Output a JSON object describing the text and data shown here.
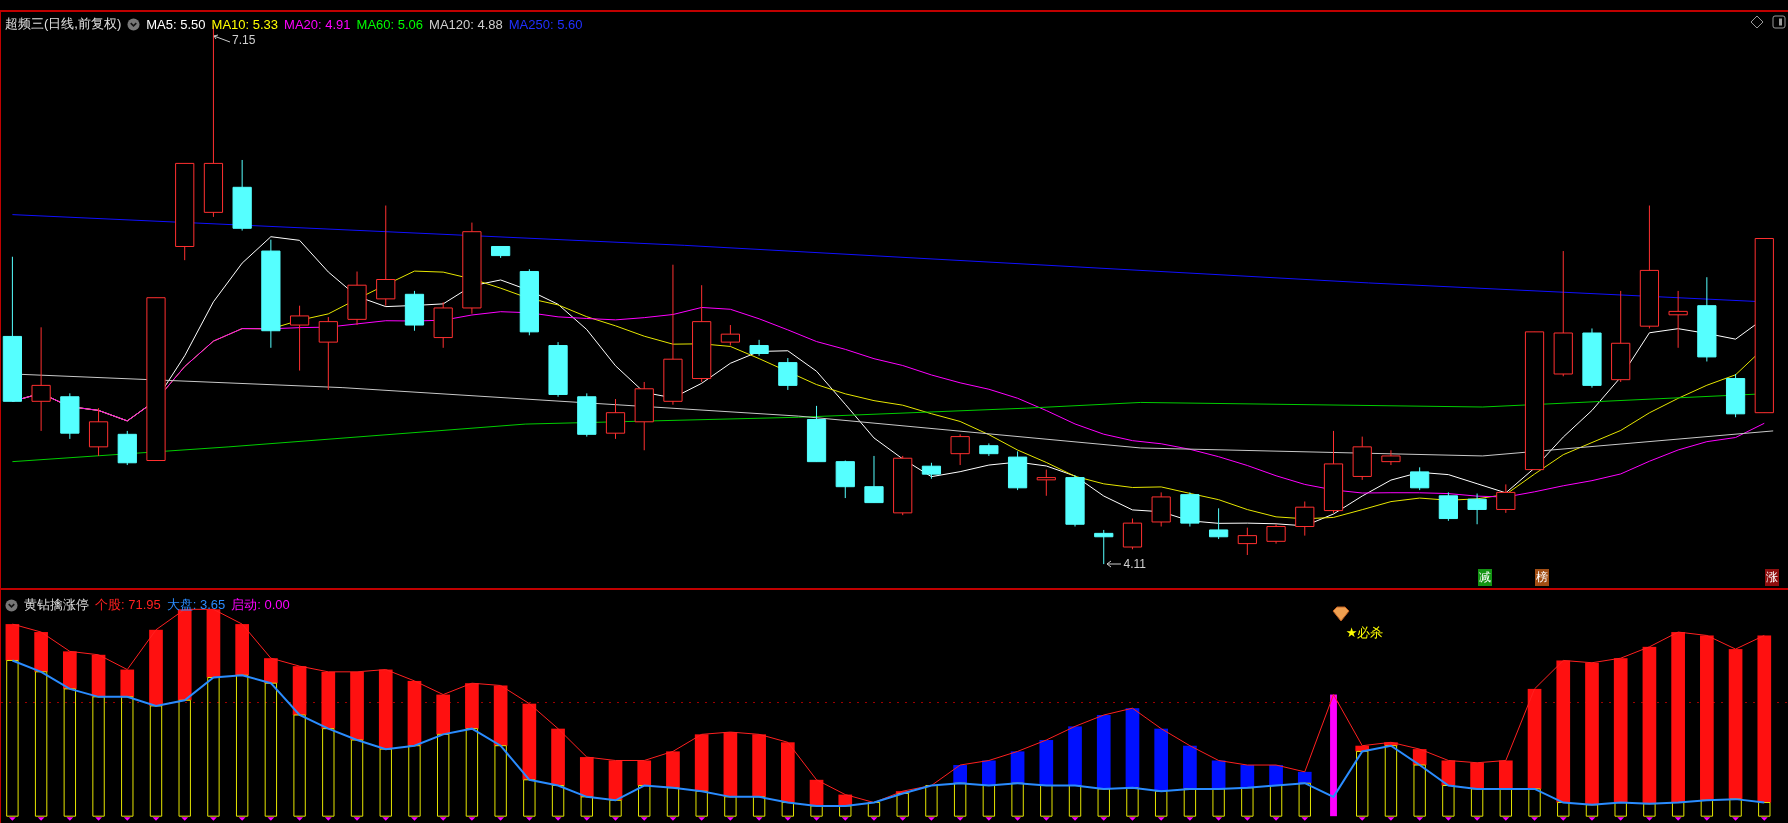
{
  "main_panel": {
    "title": "超频三(日线,前复权)",
    "ma_legend": [
      {
        "label": "MA5: 5.50",
        "color": "#ffffff"
      },
      {
        "label": "MA10: 5.33",
        "color": "#ffff00"
      },
      {
        "label": "MA20: 4.91",
        "color": "#ff00ff"
      },
      {
        "label": "MA60: 5.06",
        "color": "#00ff00"
      },
      {
        "label": "MA120: 4.88",
        "color": "#d0d0d0"
      },
      {
        "label": "MA250: 5.60",
        "color": "#2030ff"
      }
    ],
    "high_label": "7.15",
    "low_label": "4.11",
    "signals": [
      {
        "text": "减",
        "color": "#139413"
      },
      {
        "text": "榜",
        "color": "#a24e14"
      },
      {
        "text": "涨",
        "color": "#8e0e0e"
      }
    ]
  },
  "indicator_panel": {
    "title": "黄钻擒涨停",
    "legend": [
      {
        "label": "个股: 71.95",
        "color": "#ff2020"
      },
      {
        "label": "大盘: 3.65",
        "color": "#2a8cff"
      },
      {
        "label": "启动: 0.00",
        "color": "#ff00ff"
      }
    ],
    "signal_label": "★必杀"
  }
}
